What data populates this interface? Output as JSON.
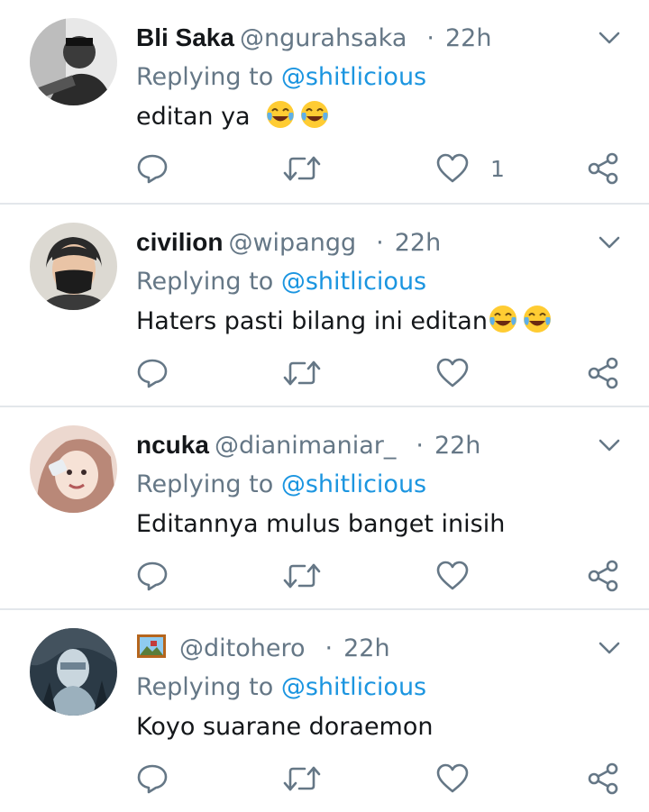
{
  "replies": [
    {
      "name": "Bli Saka",
      "handle": "@ngurahsaka",
      "time": "22h",
      "replying_prefix": "Replying to ",
      "replying_to": "@shitlicious",
      "text": "editan ya",
      "emoji": [
        "face-with-tears-of-joy",
        "face-with-tears-of-joy"
      ],
      "like_count": "1",
      "avatar_colors": [
        "#3a3a3a",
        "#cfcfcf"
      ]
    },
    {
      "name": "civilion",
      "handle": "@wipangg",
      "time": "22h",
      "replying_prefix": "Replying to ",
      "replying_to": "@shitlicious",
      "text": "Haters pasti bilang ini editan",
      "emoji": [
        "face-with-tears-of-joy",
        "face-with-tears-of-joy"
      ],
      "like_count": "",
      "avatar_colors": [
        "#d9d6cf",
        "#2a2a2a"
      ]
    },
    {
      "name": "ncuka",
      "handle": "@dianimaniar_",
      "time": "22h",
      "replying_prefix": "Replying to ",
      "replying_to": "@shitlicious",
      "text": "Editannya mulus banget inisih",
      "emoji": [],
      "like_count": "",
      "avatar_colors": [
        "#c49a86",
        "#f3e3dc"
      ]
    },
    {
      "name": "",
      "name_icon": "framed-picture-icon",
      "handle": "@ditohero",
      "time": "22h",
      "replying_prefix": "Replying to ",
      "replying_to": "@shitlicious",
      "text": "Koyo suarane doraemon",
      "emoji": [],
      "like_count": "",
      "avatar_colors": [
        "#1f2e3a",
        "#8fa8b8"
      ]
    }
  ],
  "colors": {
    "name": "#14171a",
    "secondary": "#657786",
    "mention": "#1b95e0",
    "divider": "#e3e7eb"
  }
}
